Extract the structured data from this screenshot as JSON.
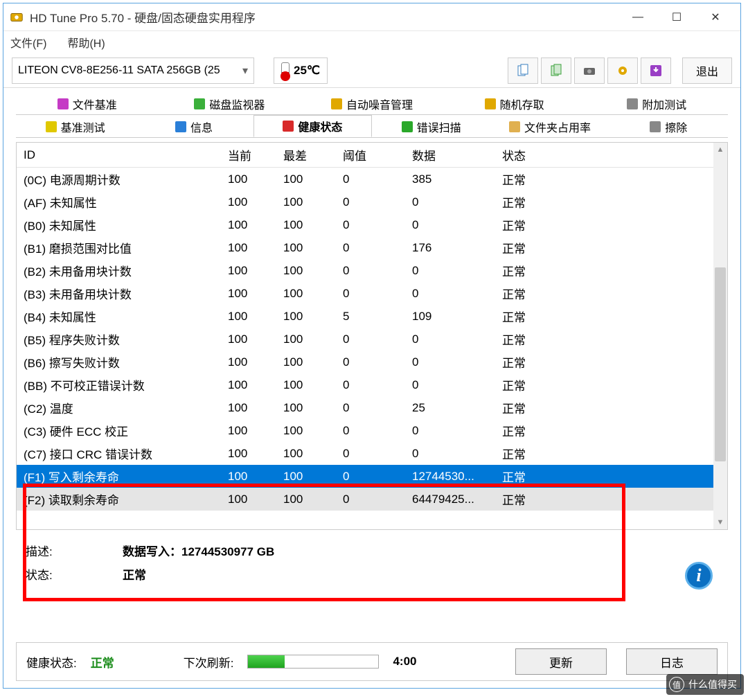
{
  "window": {
    "title": "HD Tune Pro 5.70 - 硬盘/固态硬盘实用程序"
  },
  "menu": {
    "file": "文件(F)",
    "help": "帮助(H)"
  },
  "toolbar": {
    "drive": "LITEON CV8-8E256-11 SATA 256GB (25",
    "temperature": "25℃",
    "exit": "退出"
  },
  "tabs_row1": [
    {
      "label": "文件基准",
      "icon": "#c53bc5"
    },
    {
      "label": "磁盘监视器",
      "icon": "#3bb03b"
    },
    {
      "label": "自动噪音管理",
      "icon": "#e0a800"
    },
    {
      "label": "随机存取",
      "icon": "#e0a800"
    },
    {
      "label": "附加测试",
      "icon": "#888"
    }
  ],
  "tabs_row2": [
    {
      "label": "基准测试",
      "icon": "#e0c800",
      "active": false
    },
    {
      "label": "信息",
      "icon": "#2a7fd8",
      "active": false
    },
    {
      "label": "健康状态",
      "icon": "#d82a2a",
      "active": true
    },
    {
      "label": "错误扫描",
      "icon": "#2aa82a",
      "active": false
    },
    {
      "label": "文件夹占用率",
      "icon": "#e0b050",
      "active": false
    },
    {
      "label": "擦除",
      "icon": "#888",
      "active": false
    }
  ],
  "columns": {
    "id": "ID",
    "current": "当前",
    "worst": "最差",
    "threshold": "阈值",
    "data": "数据",
    "status": "状态"
  },
  "rows": [
    {
      "id": "(0C) 电源周期计数",
      "cur": "100",
      "worst": "100",
      "thr": "0",
      "data": "385",
      "stat": "正常"
    },
    {
      "id": "(AF) 未知属性",
      "cur": "100",
      "worst": "100",
      "thr": "0",
      "data": "0",
      "stat": "正常"
    },
    {
      "id": "(B0) 未知属性",
      "cur": "100",
      "worst": "100",
      "thr": "0",
      "data": "0",
      "stat": "正常"
    },
    {
      "id": "(B1) 磨损范围对比值",
      "cur": "100",
      "worst": "100",
      "thr": "0",
      "data": "176",
      "stat": "正常"
    },
    {
      "id": "(B2) 未用备用块计数",
      "cur": "100",
      "worst": "100",
      "thr": "0",
      "data": "0",
      "stat": "正常"
    },
    {
      "id": "(B3) 未用备用块计数",
      "cur": "100",
      "worst": "100",
      "thr": "0",
      "data": "0",
      "stat": "正常"
    },
    {
      "id": "(B4) 未知属性",
      "cur": "100",
      "worst": "100",
      "thr": "5",
      "data": "109",
      "stat": "正常"
    },
    {
      "id": "(B5) 程序失败计数",
      "cur": "100",
      "worst": "100",
      "thr": "0",
      "data": "0",
      "stat": "正常"
    },
    {
      "id": "(B6) 擦写失败计数",
      "cur": "100",
      "worst": "100",
      "thr": "0",
      "data": "0",
      "stat": "正常"
    },
    {
      "id": "(BB) 不可校正错误计数",
      "cur": "100",
      "worst": "100",
      "thr": "0",
      "data": "0",
      "stat": "正常"
    },
    {
      "id": "(C2) 温度",
      "cur": "100",
      "worst": "100",
      "thr": "0",
      "data": "25",
      "stat": "正常"
    },
    {
      "id": "(C3) 硬件 ECC 校正",
      "cur": "100",
      "worst": "100",
      "thr": "0",
      "data": "0",
      "stat": "正常"
    },
    {
      "id": "(C7) 接口 CRC 错误计数",
      "cur": "100",
      "worst": "100",
      "thr": "0",
      "data": "0",
      "stat": "正常"
    },
    {
      "id": "(F1) 写入剩余寿命",
      "cur": "100",
      "worst": "100",
      "thr": "0",
      "data": "12744530...",
      "stat": "正常",
      "selected": true
    },
    {
      "id": "(F2) 读取剩余寿命",
      "cur": "100",
      "worst": "100",
      "thr": "0",
      "data": "64479425...",
      "stat": "正常",
      "alt": true
    }
  ],
  "details": {
    "desc_label": "描述:",
    "desc_value": "数据写入：12744530977 GB",
    "status_label": "状态:",
    "status_value": "正常"
  },
  "footer": {
    "health_label": "健康状态:",
    "health_value": "正常",
    "refresh_label": "下次刷新:",
    "countdown": "4:00",
    "update_btn": "更新",
    "log_btn": "日志"
  },
  "watermark": {
    "badge": "值",
    "text": "什么值得买"
  }
}
